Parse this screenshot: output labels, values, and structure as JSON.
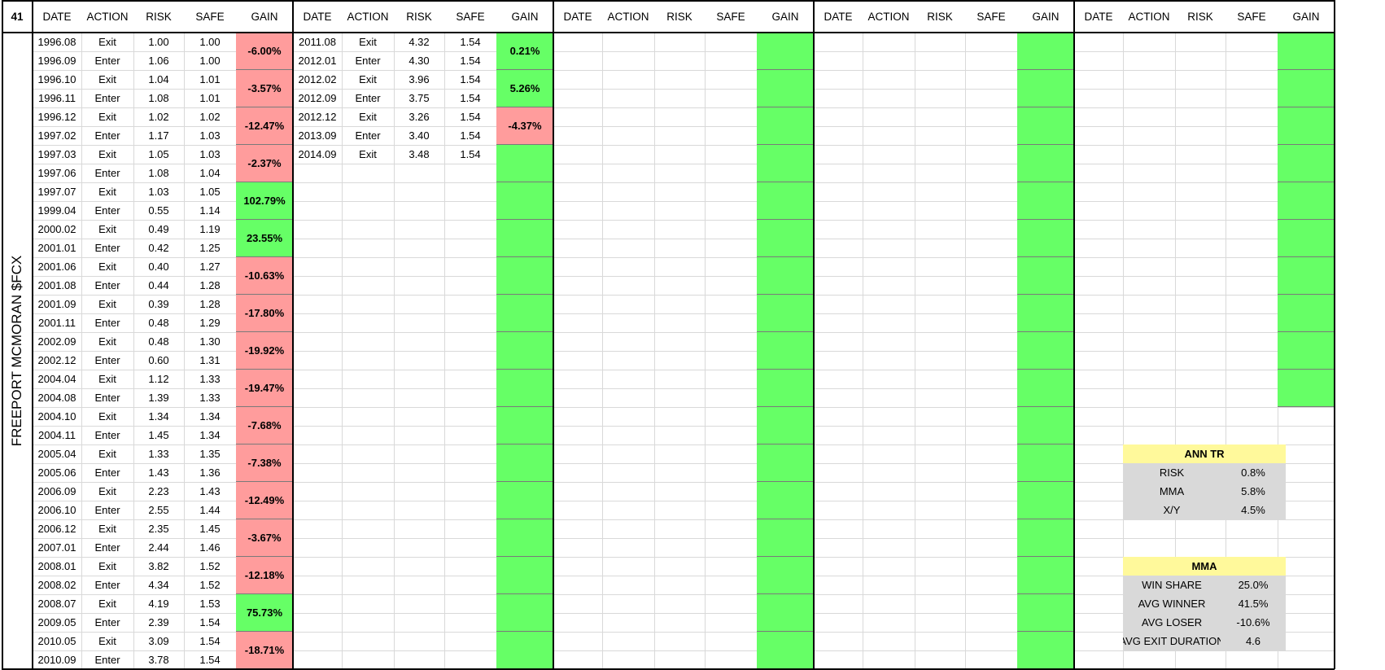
{
  "sheet": {
    "corner": "41",
    "side_title": "FREEPORT MCMORAN $FCX",
    "group_headers": [
      "DATE",
      "ACTION",
      "RISK",
      "SAFE",
      "GAIN"
    ],
    "groups": [
      {
        "trades": [
          [
            "1996.08",
            "Exit",
            "1.00",
            "1.00"
          ],
          [
            "1996.09",
            "Enter",
            "1.06",
            "1.00"
          ],
          [
            "1996.10",
            "Exit",
            "1.04",
            "1.01"
          ],
          [
            "1996.11",
            "Enter",
            "1.08",
            "1.01"
          ],
          [
            "1996.12",
            "Exit",
            "1.02",
            "1.02"
          ],
          [
            "1997.02",
            "Enter",
            "1.17",
            "1.03"
          ],
          [
            "1997.03",
            "Exit",
            "1.05",
            "1.03"
          ],
          [
            "1997.06",
            "Enter",
            "1.08",
            "1.04"
          ],
          [
            "1997.07",
            "Exit",
            "1.03",
            "1.05"
          ],
          [
            "1999.04",
            "Enter",
            "0.55",
            "1.14"
          ],
          [
            "2000.02",
            "Exit",
            "0.49",
            "1.19"
          ],
          [
            "2001.01",
            "Enter",
            "0.42",
            "1.25"
          ],
          [
            "2001.06",
            "Exit",
            "0.40",
            "1.27"
          ],
          [
            "2001.08",
            "Enter",
            "0.44",
            "1.28"
          ],
          [
            "2001.09",
            "Exit",
            "0.39",
            "1.28"
          ],
          [
            "2001.11",
            "Enter",
            "0.48",
            "1.29"
          ],
          [
            "2002.09",
            "Exit",
            "0.48",
            "1.30"
          ],
          [
            "2002.12",
            "Enter",
            "0.60",
            "1.31"
          ],
          [
            "2004.04",
            "Exit",
            "1.12",
            "1.33"
          ],
          [
            "2004.08",
            "Enter",
            "1.39",
            "1.33"
          ],
          [
            "2004.10",
            "Exit",
            "1.34",
            "1.34"
          ],
          [
            "2004.11",
            "Enter",
            "1.45",
            "1.34"
          ],
          [
            "2005.04",
            "Exit",
            "1.33",
            "1.35"
          ],
          [
            "2005.06",
            "Enter",
            "1.43",
            "1.36"
          ],
          [
            "2006.09",
            "Exit",
            "2.23",
            "1.43"
          ],
          [
            "2006.10",
            "Enter",
            "2.55",
            "1.44"
          ],
          [
            "2006.12",
            "Exit",
            "2.35",
            "1.45"
          ],
          [
            "2007.01",
            "Enter",
            "2.44",
            "1.46"
          ],
          [
            "2008.01",
            "Exit",
            "3.82",
            "1.52"
          ],
          [
            "2008.02",
            "Enter",
            "4.34",
            "1.52"
          ],
          [
            "2008.07",
            "Exit",
            "4.19",
            "1.53"
          ],
          [
            "2009.05",
            "Enter",
            "2.39",
            "1.54"
          ],
          [
            "2010.05",
            "Exit",
            "3.09",
            "1.54"
          ],
          [
            "2010.09",
            "Enter",
            "3.78",
            "1.54"
          ]
        ],
        "gains": [
          "-6.00%",
          "-3.57%",
          "-12.47%",
          "-2.37%",
          "102.79%",
          "23.55%",
          "-10.63%",
          "-17.80%",
          "-19.92%",
          "-19.47%",
          "-7.68%",
          "-7.38%",
          "-12.49%",
          "-3.67%",
          "-12.18%",
          "75.73%",
          "-18.71%"
        ]
      },
      {
        "trades": [
          [
            "2011.08",
            "Exit",
            "4.32",
            "1.54"
          ],
          [
            "2012.01",
            "Enter",
            "4.30",
            "1.54"
          ],
          [
            "2012.02",
            "Exit",
            "3.96",
            "1.54"
          ],
          [
            "2012.09",
            "Enter",
            "3.75",
            "1.54"
          ],
          [
            "2012.12",
            "Exit",
            "3.26",
            "1.54"
          ],
          [
            "2013.09",
            "Enter",
            "3.40",
            "1.54"
          ],
          [
            "2014.09",
            "Exit",
            "3.48",
            "1.54"
          ]
        ],
        "gains": [
          "0.21%",
          "5.26%",
          "-4.37%",
          "",
          "",
          "",
          "",
          "",
          "",
          "",
          "",
          "",
          "",
          "",
          "",
          "",
          ""
        ]
      },
      {
        "trades": [],
        "gains": [
          "",
          "",
          "",
          "",
          "",
          "",
          "",
          "",
          "",
          "",
          "",
          "",
          "",
          "",
          "",
          "",
          ""
        ]
      },
      {
        "trades": [],
        "gains": [
          "",
          "",
          "",
          "",
          "",
          "",
          "",
          "",
          "",
          "",
          "",
          "",
          "",
          "",
          "",
          "",
          ""
        ]
      },
      {
        "trades": [],
        "gains": [
          "",
          "",
          "",
          "",
          "",
          "",
          "",
          "",
          "",
          ""
        ]
      }
    ],
    "colors": {
      "negative": "#ff9c9c",
      "positive": "#66ff66",
      "panel_title": "#fff99b",
      "panel_row": "#d9d9d9"
    }
  },
  "ann_tr": {
    "title": "ANN TR",
    "rows": [
      {
        "label": "RISK",
        "value": "0.8%"
      },
      {
        "label": "MMA",
        "value": "5.8%"
      },
      {
        "label": "X/Y",
        "value": "4.5%"
      }
    ]
  },
  "mma": {
    "title": "MMA",
    "rows": [
      {
        "label": "WIN SHARE",
        "value": "25.0%"
      },
      {
        "label": "AVG WINNER",
        "value": "41.5%"
      },
      {
        "label": "AVG LOSER",
        "value": "-10.6%"
      },
      {
        "label": "AVG EXIT DURATION",
        "value": "4.6"
      }
    ]
  }
}
